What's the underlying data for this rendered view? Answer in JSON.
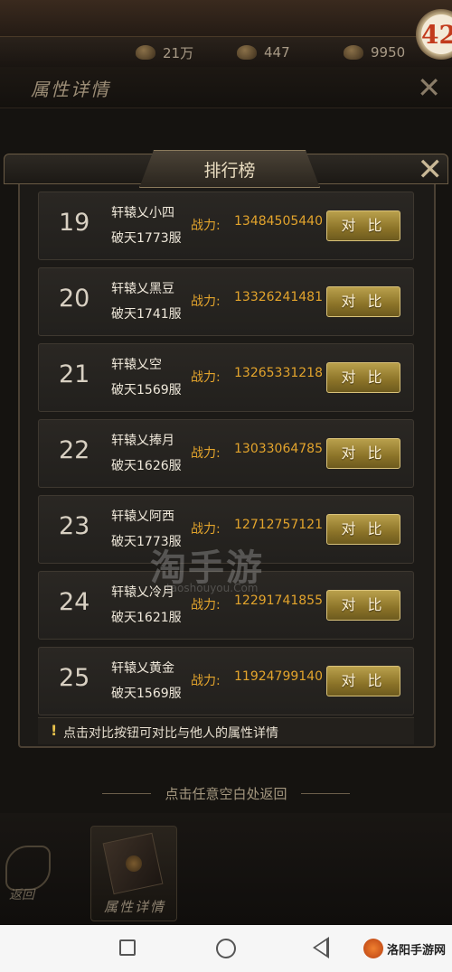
{
  "currency": [
    {
      "icon": "silver-ingot-icon",
      "value": "21万"
    },
    {
      "icon": "gold-ingot-icon",
      "value": "447"
    },
    {
      "icon": "yuanbao-icon",
      "value": "9950"
    }
  ],
  "level_badge": "42",
  "section": {
    "title": "属性详情"
  },
  "panel": {
    "title": "排行榜",
    "power_label": "战力:",
    "compare_label": "对 比",
    "rows": [
      {
        "rank": "19",
        "name": "轩辕乂小四",
        "server": "破天1773服",
        "power": "13484505440"
      },
      {
        "rank": "20",
        "name": "轩辕乂黑豆",
        "server": "破天1741服",
        "power": "13326241481"
      },
      {
        "rank": "21",
        "name": "轩辕乂空",
        "server": "破天1569服",
        "power": "13265331218"
      },
      {
        "rank": "22",
        "name": "轩辕乂捧月",
        "server": "破天1626服",
        "power": "13033064785"
      },
      {
        "rank": "23",
        "name": "轩辕乂阿西",
        "server": "破天1773服",
        "power": "12712757121"
      },
      {
        "rank": "24",
        "name": "轩辕乂冷月",
        "server": "破天1621服",
        "power": "12291741855"
      },
      {
        "rank": "25",
        "name": "轩辕乂黄金",
        "server": "破天1569服",
        "power": "11924799140"
      }
    ],
    "tip": "点击对比按钮可对比与他人的属性详情"
  },
  "hint": "点击任意空白处返回",
  "bottom_tabs": {
    "back": "返回",
    "attributes": "属性详情"
  },
  "watermark": {
    "main": "淘手游",
    "sub": "taoshouyou.Com"
  },
  "nav_badge": "洛阳手游网"
}
